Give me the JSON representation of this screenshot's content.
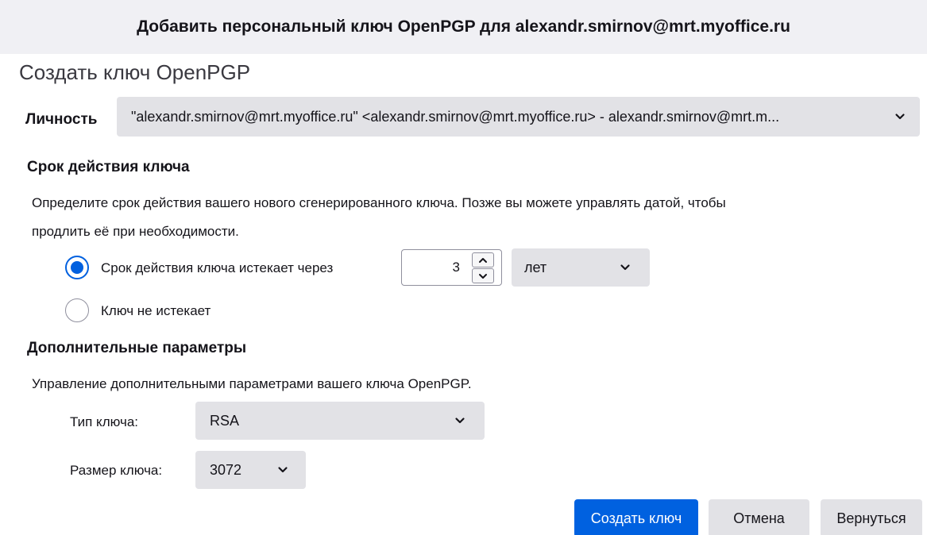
{
  "dialog": {
    "title": "Добавить персональный ключ OpenPGP для alexandr.smirnov@mrt.myoffice.ru",
    "heading": "Создать ключ OpenPGP"
  },
  "identity": {
    "label": "Личность",
    "value": "\"alexandr.smirnov@mrt.myoffice.ru\" <alexandr.smirnov@mrt.myoffice.ru> - alexandr.smirnov@mrt.m..."
  },
  "expiry": {
    "title": "Срок действия ключа",
    "description_line1": "Определите срок действия вашего нового сгенерированного ключа. Позже вы можете управлять датой, чтобы",
    "description_line2": "продлить её при необходимости.",
    "option_expires_label": "Срок действия ключа истекает через",
    "option_expires_checked": true,
    "amount": "3",
    "unit": "лет",
    "option_never_label": "Ключ не истекает",
    "option_never_checked": false
  },
  "advanced": {
    "title": "Дополнительные параметры",
    "description": "Управление дополнительными параметрами вашего ключа OpenPGP.",
    "key_type_label": "Тип ключа:",
    "key_type_value": "RSA",
    "key_size_label": "Размер ключа:",
    "key_size_value": "3072"
  },
  "buttons": {
    "create": "Создать ключ",
    "cancel": "Отмена",
    "back": "Вернуться"
  },
  "colors": {
    "accent": "#0061e0",
    "titlebar": "#f0f0f4",
    "field": "#e2e2e6"
  },
  "icons": [
    "chevron-down-icon",
    "spinner-up-icon",
    "spinner-down-icon"
  ]
}
